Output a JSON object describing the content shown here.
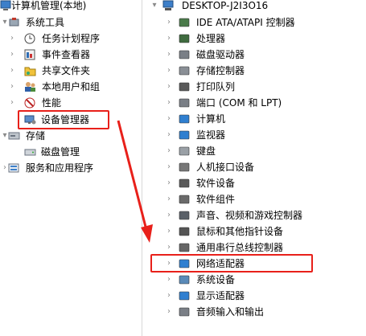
{
  "left_tree": {
    "root": "计算机管理(本地)",
    "system_tools": "系统工具",
    "items": [
      "任务计划程序",
      "事件查看器",
      "共享文件夹",
      "本地用户和组",
      "性能",
      "设备管理器"
    ],
    "storage": "存储",
    "disk_mgmt": "磁盘管理",
    "services": "服务和应用程序"
  },
  "right_tree": {
    "computer_name": "DESKTOP-J2I3O16",
    "devices": [
      "IDE ATA/ATAPI 控制器",
      "处理器",
      "磁盘驱动器",
      "存储控制器",
      "打印队列",
      "端口 (COM 和 LPT)",
      "计算机",
      "监视器",
      "键盘",
      "人机接口设备",
      "软件设备",
      "软件组件",
      "声音、视频和游戏控制器",
      "鼠标和其他指针设备",
      "通用串行总线控制器",
      "网络适配器",
      "系统设备",
      "显示适配器",
      "音频输入和输出"
    ]
  },
  "highlight_color": "#e8201a",
  "icons": {
    "root": "computer-management-icon",
    "system_tools": "tools-icon",
    "task_scheduler": "clock-icon",
    "event_viewer": "event-log-icon",
    "shared_folders": "shared-folder-icon",
    "local_users": "users-icon",
    "performance": "performance-icon",
    "device_manager": "device-manager-icon",
    "storage": "storage-icon",
    "disk_mgmt": "disk-icon",
    "services": "services-icon"
  }
}
